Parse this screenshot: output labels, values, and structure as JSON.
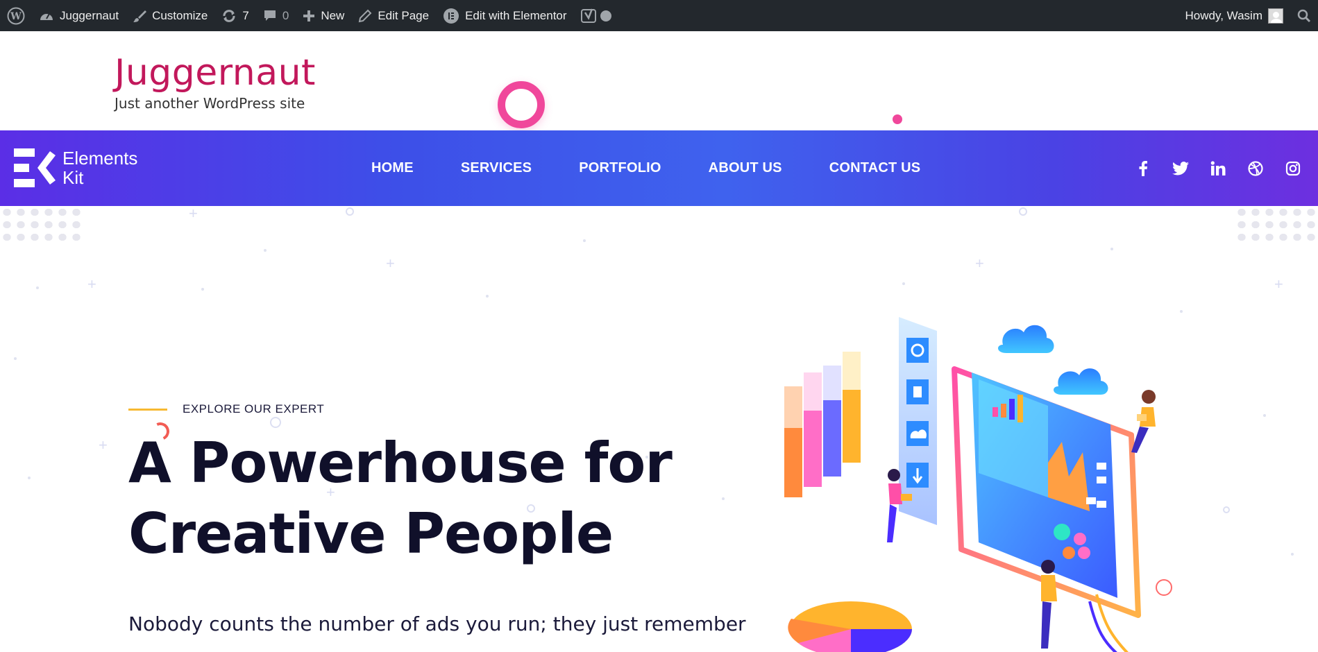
{
  "admin_bar": {
    "site_name": "Juggernaut",
    "customize": "Customize",
    "updates_count": "7",
    "comments_count": "0",
    "new": "New",
    "edit_page": "Edit Page",
    "edit_elementor": "Edit with Elementor",
    "howdy": "Howdy, Wasim"
  },
  "site": {
    "title": "Juggernaut",
    "description": "Just another WordPress site"
  },
  "logo": {
    "line1": "Elements",
    "line2": "Kit"
  },
  "nav": {
    "items": [
      {
        "label": "HOME"
      },
      {
        "label": "SERVICES"
      },
      {
        "label": "PORTFOLIO"
      },
      {
        "label": "ABOUT US"
      },
      {
        "label": "CONTACT US"
      }
    ],
    "social": [
      "facebook-icon",
      "twitter-icon",
      "linkedin-icon",
      "dribbble-icon",
      "instagram-icon"
    ]
  },
  "hero": {
    "kicker": "EXPLORE OUR EXPERT",
    "headline_line1": "A Powerhouse for",
    "headline_line2": "Creative People",
    "lead": "Nobody counts the number of ads you run; they just remember"
  },
  "colors": {
    "adminbar": "#23282d",
    "site_title": "#c2185b",
    "nav_start": "#5b2ee6",
    "nav_mid": "#3f62ee",
    "accent_pink": "#f0479b",
    "kicker_line": "#f7b932",
    "headline": "#10102a"
  }
}
